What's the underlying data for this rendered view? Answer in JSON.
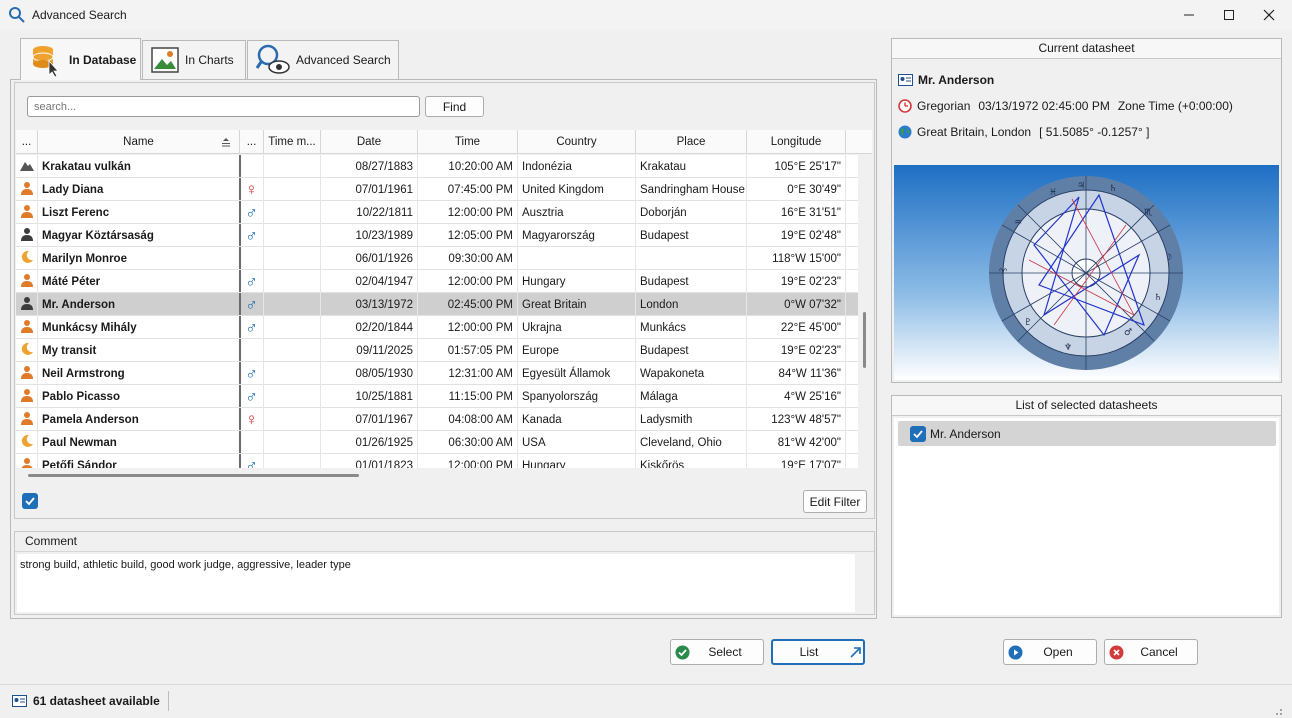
{
  "window": {
    "title": "Advanced Search"
  },
  "tabs": [
    {
      "label": "In Database"
    },
    {
      "label": "In Charts"
    },
    {
      "label": "Advanced Search"
    }
  ],
  "search": {
    "placeholder": "search...",
    "find_label": "Find"
  },
  "table": {
    "columns": [
      "...",
      "Name",
      "...",
      "Time m...",
      "Date",
      "Time",
      "Country",
      "Place",
      "Longitude"
    ],
    "rows": [
      {
        "icon": "mountain-icon",
        "name": "Krakatau vulkán",
        "gender": "",
        "date": "08/27/1883",
        "time": "10:20:00 AM",
        "country": "Indonézia",
        "place": "Krakatau",
        "longitude": "105°E 25'17\""
      },
      {
        "icon": "person-icon",
        "name": "Lady Diana",
        "gender": "♀",
        "date": "07/01/1961",
        "time": "07:45:00 PM",
        "country": "United Kingdom",
        "place": "Sandringham House",
        "longitude": "0°E 30'49\""
      },
      {
        "icon": "person-icon",
        "name": "Liszt Ferenc",
        "gender": "♂",
        "date": "10/22/1811",
        "time": "12:00:00 PM",
        "country": "Ausztria",
        "place": "Doborján",
        "longitude": "16°E 31'51\""
      },
      {
        "icon": "person-dark-icon",
        "name": "Magyar Köztársaság",
        "gender": "♂",
        "date": "10/23/1989",
        "time": "12:05:00 PM",
        "country": "Magyarország",
        "place": "Budapest",
        "longitude": "19°E 02'48\""
      },
      {
        "icon": "moon-icon",
        "name": "Marilyn Monroe",
        "gender": "",
        "date": "06/01/1926",
        "time": "09:30:00 AM",
        "country": "",
        "place": "",
        "longitude": "118°W 15'00\""
      },
      {
        "icon": "person-icon",
        "name": "Máté Péter",
        "gender": "♂",
        "date": "02/04/1947",
        "time": "12:00:00 PM",
        "country": "Hungary",
        "place": "Budapest",
        "longitude": "19°E 02'23\""
      },
      {
        "icon": "person-dark-icon",
        "name": "Mr. Anderson",
        "gender": "♂",
        "date": "03/13/1972",
        "time": "02:45:00 PM",
        "country": "Great Britain",
        "place": "London",
        "longitude": "0°W 07'32\"",
        "selected": true
      },
      {
        "icon": "person-icon",
        "name": "Munkácsy Mihály",
        "gender": "♂",
        "date": "02/20/1844",
        "time": "12:00:00 PM",
        "country": "Ukrajna",
        "place": "Munkács",
        "longitude": "22°E 45'00\""
      },
      {
        "icon": "moon-icon",
        "name": "My transit",
        "gender": "",
        "date": "09/11/2025",
        "time": "01:57:05 PM",
        "country": "Europe",
        "place": "Budapest",
        "longitude": "19°E 02'23\""
      },
      {
        "icon": "person-icon",
        "name": "Neil Armstrong",
        "gender": "♂",
        "date": "08/05/1930",
        "time": "12:31:00 AM",
        "country": "Egyesült Államok",
        "place": "Wapakoneta",
        "longitude": "84°W 11'36\""
      },
      {
        "icon": "person-icon",
        "name": "Pablo Picasso",
        "gender": "♂",
        "date": "10/25/1881",
        "time": "11:15:00 PM",
        "country": "Spanyolország",
        "place": "Málaga",
        "longitude": "4°W 25'16\""
      },
      {
        "icon": "person-icon",
        "name": "Pamela Anderson",
        "gender": "♀",
        "date": "07/01/1967",
        "time": "04:08:00 AM",
        "country": "Kanada",
        "place": "Ladysmith",
        "longitude": "123°W 48'57\""
      },
      {
        "icon": "moon-icon",
        "name": "Paul Newman",
        "gender": "",
        "date": "01/26/1925",
        "time": "06:30:00 AM",
        "country": "USA",
        "place": "Cleveland, Ohio",
        "longitude": "81°W 42'00\""
      },
      {
        "icon": "person-icon",
        "name": "Petőfi Sándor",
        "gender": "♂",
        "date": "01/01/1823",
        "time": "12:00:00 PM",
        "country": "Hungary",
        "place": "Kiskőrös",
        "longitude": "19°E 17'07\""
      }
    ]
  },
  "edit_filter_label": "Edit Filter",
  "comment": {
    "label": "Comment",
    "text": "strong build, athletic build, good work judge, aggressive, leader type"
  },
  "current": {
    "title": "Current datasheet",
    "name": "Mr. Anderson",
    "calendar": "Gregorian",
    "datetime": "03/13/1972 02:45:00 PM",
    "zone": "Zone Time (+0:00:00)",
    "location": "Great Britain, London",
    "coords": "[ 51.5085°  -0.1257° ]"
  },
  "selected_list": {
    "title": "List of selected datasheets",
    "items": [
      "Mr. Anderson"
    ]
  },
  "buttons": {
    "select": "Select",
    "list": "List",
    "open": "Open",
    "cancel": "Cancel"
  },
  "status": {
    "text": "61 datasheet available"
  },
  "colors": {
    "accent": "#1f6fb8",
    "female": "#d23b3b",
    "person": "#e07b2a"
  }
}
